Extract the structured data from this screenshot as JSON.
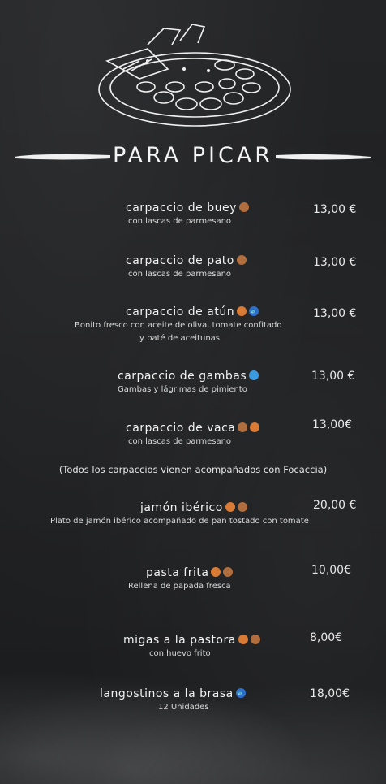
{
  "section": {
    "title": "PARA PICAR"
  },
  "items": [
    {
      "name": "carpaccio de buey",
      "desc": "con lascas de parmesano",
      "price": "13,00 €"
    },
    {
      "name": "carpaccio de pato",
      "desc": "con lascas de parmesano",
      "price": "13,00 €"
    },
    {
      "name": "carpaccio de atún",
      "desc": "Bonito fresco con aceite de oliva, tomate confitado",
      "desc2": "y paté de aceitunas",
      "price": "13,00 €"
    },
    {
      "name": "carpaccio de gambas",
      "desc": "Gambas y lágrimas de pimiento",
      "price": "13,00 €"
    },
    {
      "name": "carpaccio de vaca",
      "desc": "con lascas de parmesano",
      "price": "13,00€"
    },
    {
      "name": "jamón ibérico",
      "desc": "Plato de jamón ibérico acompañado de pan tostado con tomate",
      "price": "20,00 €"
    },
    {
      "name": "pasta frita",
      "desc": "Rellena de papada fresca",
      "price": "10,00€"
    },
    {
      "name": "migas a la pastora",
      "desc": "con huevo frito",
      "price": "8,00€"
    },
    {
      "name": "langostinos a la brasa",
      "desc": "12 Unidades",
      "price": "18,00€"
    }
  ],
  "note": "(Todos los carpaccios vienen acompañados con Focaccia)",
  "icons": {
    "allergen_colors": {
      "brown": "#b06d3d",
      "orange": "#d97a35",
      "blue": "#2f6fcf",
      "lightblue": "#3c9be0"
    }
  }
}
